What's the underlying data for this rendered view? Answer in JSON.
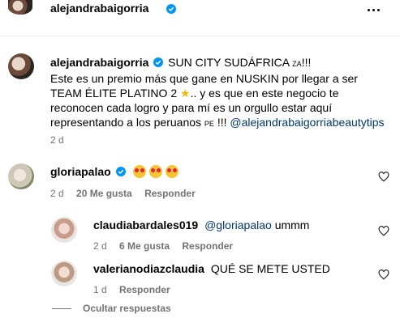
{
  "post": {
    "author": "alejandrabaigorria"
  },
  "caption": {
    "author": "alejandrabaigorria",
    "text_part1": "SUN CITY SUDÁFRICA",
    "flag1": "ZA",
    "text_part1b": "!!!",
    "text_part2": "Este es un premio más que gane en NUSKIN por llegar a ser TEAM ÉLITE PLATINO 2",
    "text_part3": ".. y es que en este negocio te reconocen cada logro y para mí es un orgullo estar aquí representando a los peruanos",
    "flag2": "PE",
    "text_part4": "!!!",
    "mention": "@alejandrabaigorriabeautytips",
    "time": "2 d"
  },
  "comments": [
    {
      "author": "gloriapalao",
      "verified": true,
      "time": "2 d",
      "likes": "20 Me gusta",
      "reply": "Responder"
    },
    {
      "author": "claudiabardales019",
      "mention": "@gloriapalao",
      "text": "ummm",
      "time": "2 d",
      "likes": "6 Me gusta",
      "reply": "Responder"
    },
    {
      "author": "valerianodiazclaudia",
      "text": "QUÉ SE METE USTED",
      "time": "1 d",
      "reply": "Responder"
    }
  ],
  "hide_replies": "Ocultar respuestas",
  "colors": {
    "verified": "#0095f6",
    "mention": "#00376b",
    "meta": "#737373"
  }
}
